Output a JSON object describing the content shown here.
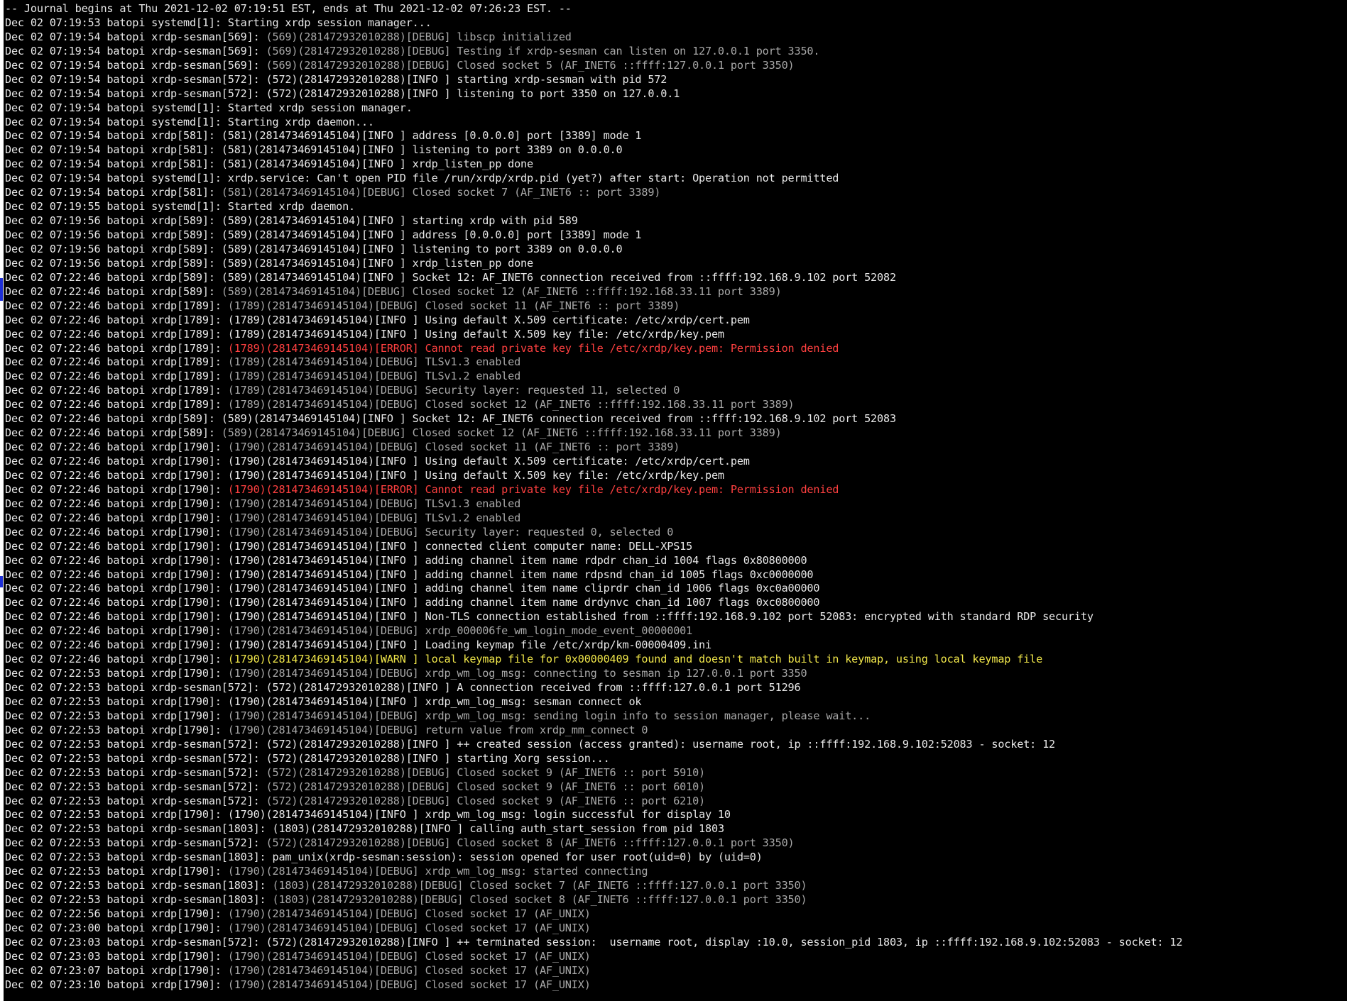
{
  "journal_header": "-- Journal begins at Thu 2021-12-02 07:19:51 EST, ends at Thu 2021-12-02 07:26:23 EST. --",
  "colors": {
    "background": "#000000",
    "info": "#e8e8e8",
    "debug": "#a8a8a8",
    "error": "#ff4040",
    "warn": "#f0e64a"
  },
  "lines": [
    {
      "p": "Dec 02 07:19:53 batopi systemd[1]: ",
      "m": "Starting xrdp session manager...",
      "l": "plain"
    },
    {
      "p": "Dec 02 07:19:54 batopi xrdp-sesman[569]: ",
      "m": "(569)(281472932010288)[DEBUG] libscp initialized",
      "l": "debug"
    },
    {
      "p": "Dec 02 07:19:54 batopi xrdp-sesman[569]: ",
      "m": "(569)(281472932010288)[DEBUG] Testing if xrdp-sesman can listen on 127.0.0.1 port 3350.",
      "l": "debug"
    },
    {
      "p": "Dec 02 07:19:54 batopi xrdp-sesman[569]: ",
      "m": "(569)(281472932010288)[DEBUG] Closed socket 5 (AF_INET6 ::ffff:127.0.0.1 port 3350)",
      "l": "debug"
    },
    {
      "p": "Dec 02 07:19:54 batopi xrdp-sesman[572]: ",
      "m": "(572)(281472932010288)[INFO ] starting xrdp-sesman with pid 572",
      "l": "info"
    },
    {
      "p": "Dec 02 07:19:54 batopi xrdp-sesman[572]: ",
      "m": "(572)(281472932010288)[INFO ] listening to port 3350 on 127.0.0.1",
      "l": "info"
    },
    {
      "p": "Dec 02 07:19:54 batopi systemd[1]: ",
      "m": "Started xrdp session manager.",
      "l": "plain"
    },
    {
      "p": "Dec 02 07:19:54 batopi systemd[1]: ",
      "m": "Starting xrdp daemon...",
      "l": "plain"
    },
    {
      "p": "Dec 02 07:19:54 batopi xrdp[581]: ",
      "m": "(581)(281473469145104)[INFO ] address [0.0.0.0] port [3389] mode 1",
      "l": "info"
    },
    {
      "p": "Dec 02 07:19:54 batopi xrdp[581]: ",
      "m": "(581)(281473469145104)[INFO ] listening to port 3389 on 0.0.0.0",
      "l": "info"
    },
    {
      "p": "Dec 02 07:19:54 batopi xrdp[581]: ",
      "m": "(581)(281473469145104)[INFO ] xrdp_listen_pp done",
      "l": "info"
    },
    {
      "p": "Dec 02 07:19:54 batopi systemd[1]: ",
      "m": "xrdp.service: Can't open PID file /run/xrdp/xrdp.pid (yet?) after start: Operation not permitted",
      "l": "plain"
    },
    {
      "p": "Dec 02 07:19:54 batopi xrdp[581]: ",
      "m": "(581)(281473469145104)[DEBUG] Closed socket 7 (AF_INET6 :: port 3389)",
      "l": "debug"
    },
    {
      "p": "Dec 02 07:19:55 batopi systemd[1]: ",
      "m": "Started xrdp daemon.",
      "l": "plain"
    },
    {
      "p": "Dec 02 07:19:56 batopi xrdp[589]: ",
      "m": "(589)(281473469145104)[INFO ] starting xrdp with pid 589",
      "l": "info"
    },
    {
      "p": "Dec 02 07:19:56 batopi xrdp[589]: ",
      "m": "(589)(281473469145104)[INFO ] address [0.0.0.0] port [3389] mode 1",
      "l": "info"
    },
    {
      "p": "Dec 02 07:19:56 batopi xrdp[589]: ",
      "m": "(589)(281473469145104)[INFO ] listening to port 3389 on 0.0.0.0",
      "l": "info"
    },
    {
      "p": "Dec 02 07:19:56 batopi xrdp[589]: ",
      "m": "(589)(281473469145104)[INFO ] xrdp_listen_pp done",
      "l": "info"
    },
    {
      "p": "Dec 02 07:22:46 batopi xrdp[589]: ",
      "m": "(589)(281473469145104)[INFO ] Socket 12: AF_INET6 connection received from ::ffff:192.168.9.102 port 52082",
      "l": "info"
    },
    {
      "p": "Dec 02 07:22:46 batopi xrdp[589]: ",
      "m": "(589)(281473469145104)[DEBUG] Closed socket 12 (AF_INET6 ::ffff:192.168.33.11 port 3389)",
      "l": "debug"
    },
    {
      "p": "Dec 02 07:22:46 batopi xrdp[1789]: ",
      "m": "(1789)(281473469145104)[DEBUG] Closed socket 11 (AF_INET6 :: port 3389)",
      "l": "debug"
    },
    {
      "p": "Dec 02 07:22:46 batopi xrdp[1789]: ",
      "m": "(1789)(281473469145104)[INFO ] Using default X.509 certificate: /etc/xrdp/cert.pem",
      "l": "info"
    },
    {
      "p": "Dec 02 07:22:46 batopi xrdp[1789]: ",
      "m": "(1789)(281473469145104)[INFO ] Using default X.509 key file: /etc/xrdp/key.pem",
      "l": "info"
    },
    {
      "p": "Dec 02 07:22:46 batopi xrdp[1789]: ",
      "m": "(1789)(281473469145104)[ERROR] Cannot read private key file /etc/xrdp/key.pem: Permission denied",
      "l": "error"
    },
    {
      "p": "Dec 02 07:22:46 batopi xrdp[1789]: ",
      "m": "(1789)(281473469145104)[DEBUG] TLSv1.3 enabled",
      "l": "debug"
    },
    {
      "p": "Dec 02 07:22:46 batopi xrdp[1789]: ",
      "m": "(1789)(281473469145104)[DEBUG] TLSv1.2 enabled",
      "l": "debug"
    },
    {
      "p": "Dec 02 07:22:46 batopi xrdp[1789]: ",
      "m": "(1789)(281473469145104)[DEBUG] Security layer: requested 11, selected 0",
      "l": "debug"
    },
    {
      "p": "Dec 02 07:22:46 batopi xrdp[1789]: ",
      "m": "(1789)(281473469145104)[DEBUG] Closed socket 12 (AF_INET6 ::ffff:192.168.33.11 port 3389)",
      "l": "debug"
    },
    {
      "p": "Dec 02 07:22:46 batopi xrdp[589]: ",
      "m": "(589)(281473469145104)[INFO ] Socket 12: AF_INET6 connection received from ::ffff:192.168.9.102 port 52083",
      "l": "info"
    },
    {
      "p": "Dec 02 07:22:46 batopi xrdp[589]: ",
      "m": "(589)(281473469145104)[DEBUG] Closed socket 12 (AF_INET6 ::ffff:192.168.33.11 port 3389)",
      "l": "debug"
    },
    {
      "p": "Dec 02 07:22:46 batopi xrdp[1790]: ",
      "m": "(1790)(281473469145104)[DEBUG] Closed socket 11 (AF_INET6 :: port 3389)",
      "l": "debug"
    },
    {
      "p": "Dec 02 07:22:46 batopi xrdp[1790]: ",
      "m": "(1790)(281473469145104)[INFO ] Using default X.509 certificate: /etc/xrdp/cert.pem",
      "l": "info"
    },
    {
      "p": "Dec 02 07:22:46 batopi xrdp[1790]: ",
      "m": "(1790)(281473469145104)[INFO ] Using default X.509 key file: /etc/xrdp/key.pem",
      "l": "info"
    },
    {
      "p": "Dec 02 07:22:46 batopi xrdp[1790]: ",
      "m": "(1790)(281473469145104)[ERROR] Cannot read private key file /etc/xrdp/key.pem: Permission denied",
      "l": "error"
    },
    {
      "p": "Dec 02 07:22:46 batopi xrdp[1790]: ",
      "m": "(1790)(281473469145104)[DEBUG] TLSv1.3 enabled",
      "l": "debug"
    },
    {
      "p": "Dec 02 07:22:46 batopi xrdp[1790]: ",
      "m": "(1790)(281473469145104)[DEBUG] TLSv1.2 enabled",
      "l": "debug"
    },
    {
      "p": "Dec 02 07:22:46 batopi xrdp[1790]: ",
      "m": "(1790)(281473469145104)[DEBUG] Security layer: requested 0, selected 0",
      "l": "debug"
    },
    {
      "p": "Dec 02 07:22:46 batopi xrdp[1790]: ",
      "m": "(1790)(281473469145104)[INFO ] connected client computer name: DELL-XPS15",
      "l": "info"
    },
    {
      "p": "Dec 02 07:22:46 batopi xrdp[1790]: ",
      "m": "(1790)(281473469145104)[INFO ] adding channel item name rdpdr chan_id 1004 flags 0x80800000",
      "l": "info"
    },
    {
      "p": "Dec 02 07:22:46 batopi xrdp[1790]: ",
      "m": "(1790)(281473469145104)[INFO ] adding channel item name rdpsnd chan_id 1005 flags 0xc0000000",
      "l": "info"
    },
    {
      "p": "Dec 02 07:22:46 batopi xrdp[1790]: ",
      "m": "(1790)(281473469145104)[INFO ] adding channel item name cliprdr chan_id 1006 flags 0xc0a00000",
      "l": "info"
    },
    {
      "p": "Dec 02 07:22:46 batopi xrdp[1790]: ",
      "m": "(1790)(281473469145104)[INFO ] adding channel item name drdynvc chan_id 1007 flags 0xc0800000",
      "l": "info"
    },
    {
      "p": "Dec 02 07:22:46 batopi xrdp[1790]: ",
      "m": "(1790)(281473469145104)[INFO ] Non-TLS connection established from ::ffff:192.168.9.102 port 52083: encrypted with standard RDP security",
      "l": "info"
    },
    {
      "p": "Dec 02 07:22:46 batopi xrdp[1790]: ",
      "m": "(1790)(281473469145104)[DEBUG] xrdp_000006fe_wm_login_mode_event_00000001",
      "l": "debug"
    },
    {
      "p": "Dec 02 07:22:46 batopi xrdp[1790]: ",
      "m": "(1790)(281473469145104)[INFO ] Loading keymap file /etc/xrdp/km-00000409.ini",
      "l": "info"
    },
    {
      "p": "Dec 02 07:22:46 batopi xrdp[1790]: ",
      "m": "(1790)(281473469145104)[WARN ] local keymap file for 0x00000409 found and doesn't match built in keymap, using local keymap file",
      "l": "warn"
    },
    {
      "p": "Dec 02 07:22:53 batopi xrdp[1790]: ",
      "m": "(1790)(281473469145104)[DEBUG] xrdp_wm_log_msg: connecting to sesman ip 127.0.0.1 port 3350",
      "l": "debug"
    },
    {
      "p": "Dec 02 07:22:53 batopi xrdp-sesman[572]: ",
      "m": "(572)(281472932010288)[INFO ] A connection received from ::ffff:127.0.0.1 port 51296",
      "l": "info"
    },
    {
      "p": "Dec 02 07:22:53 batopi xrdp[1790]: ",
      "m": "(1790)(281473469145104)[INFO ] xrdp_wm_log_msg: sesman connect ok",
      "l": "info"
    },
    {
      "p": "Dec 02 07:22:53 batopi xrdp[1790]: ",
      "m": "(1790)(281473469145104)[DEBUG] xrdp_wm_log_msg: sending login info to session manager, please wait...",
      "l": "debug"
    },
    {
      "p": "Dec 02 07:22:53 batopi xrdp[1790]: ",
      "m": "(1790)(281473469145104)[DEBUG] return value from xrdp_mm_connect 0",
      "l": "debug"
    },
    {
      "p": "Dec 02 07:22:53 batopi xrdp-sesman[572]: ",
      "m": "(572)(281472932010288)[INFO ] ++ created session (access granted): username root, ip ::ffff:192.168.9.102:52083 - socket: 12",
      "l": "info"
    },
    {
      "p": "Dec 02 07:22:53 batopi xrdp-sesman[572]: ",
      "m": "(572)(281472932010288)[INFO ] starting Xorg session...",
      "l": "info"
    },
    {
      "p": "Dec 02 07:22:53 batopi xrdp-sesman[572]: ",
      "m": "(572)(281472932010288)[DEBUG] Closed socket 9 (AF_INET6 :: port 5910)",
      "l": "debug"
    },
    {
      "p": "Dec 02 07:22:53 batopi xrdp-sesman[572]: ",
      "m": "(572)(281472932010288)[DEBUG] Closed socket 9 (AF_INET6 :: port 6010)",
      "l": "debug"
    },
    {
      "p": "Dec 02 07:22:53 batopi xrdp-sesman[572]: ",
      "m": "(572)(281472932010288)[DEBUG] Closed socket 9 (AF_INET6 :: port 6210)",
      "l": "debug"
    },
    {
      "p": "Dec 02 07:22:53 batopi xrdp[1790]: ",
      "m": "(1790)(281473469145104)[INFO ] xrdp_wm_log_msg: login successful for display 10",
      "l": "info"
    },
    {
      "p": "Dec 02 07:22:53 batopi xrdp-sesman[1803]: ",
      "m": "(1803)(281472932010288)[INFO ] calling auth_start_session from pid 1803",
      "l": "info"
    },
    {
      "p": "Dec 02 07:22:53 batopi xrdp-sesman[572]: ",
      "m": "(572)(281472932010288)[DEBUG] Closed socket 8 (AF_INET6 ::ffff:127.0.0.1 port 3350)",
      "l": "debug"
    },
    {
      "p": "Dec 02 07:22:53 batopi xrdp-sesman[1803]: ",
      "m": "pam_unix(xrdp-sesman:session): session opened for user root(uid=0) by (uid=0)",
      "l": "plain"
    },
    {
      "p": "Dec 02 07:22:53 batopi xrdp[1790]: ",
      "m": "(1790)(281473469145104)[DEBUG] xrdp_wm_log_msg: started connecting",
      "l": "debug"
    },
    {
      "p": "Dec 02 07:22:53 batopi xrdp-sesman[1803]: ",
      "m": "(1803)(281472932010288)[DEBUG] Closed socket 7 (AF_INET6 ::ffff:127.0.0.1 port 3350)",
      "l": "debug"
    },
    {
      "p": "Dec 02 07:22:53 batopi xrdp-sesman[1803]: ",
      "m": "(1803)(281472932010288)[DEBUG] Closed socket 8 (AF_INET6 ::ffff:127.0.0.1 port 3350)",
      "l": "debug"
    },
    {
      "p": "Dec 02 07:22:56 batopi xrdp[1790]: ",
      "m": "(1790)(281473469145104)[DEBUG] Closed socket 17 (AF_UNIX)",
      "l": "debug"
    },
    {
      "p": "Dec 02 07:23:00 batopi xrdp[1790]: ",
      "m": "(1790)(281473469145104)[DEBUG] Closed socket 17 (AF_UNIX)",
      "l": "debug"
    },
    {
      "p": "Dec 02 07:23:03 batopi xrdp-sesman[572]: ",
      "m": "(572)(281472932010288)[INFO ] ++ terminated session:  username root, display :10.0, session_pid 1803, ip ::ffff:192.168.9.102:52083 - socket: 12",
      "l": "info"
    },
    {
      "p": "Dec 02 07:23:03 batopi xrdp[1790]: ",
      "m": "(1790)(281473469145104)[DEBUG] Closed socket 17 (AF_UNIX)",
      "l": "debug"
    },
    {
      "p": "Dec 02 07:23:07 batopi xrdp[1790]: ",
      "m": "(1790)(281473469145104)[DEBUG] Closed socket 17 (AF_UNIX)",
      "l": "debug"
    },
    {
      "p": "Dec 02 07:23:10 batopi xrdp[1790]: ",
      "m": "(1790)(281473469145104)[DEBUG] Closed socket 17 (AF_UNIX)",
      "l": "debug"
    }
  ]
}
